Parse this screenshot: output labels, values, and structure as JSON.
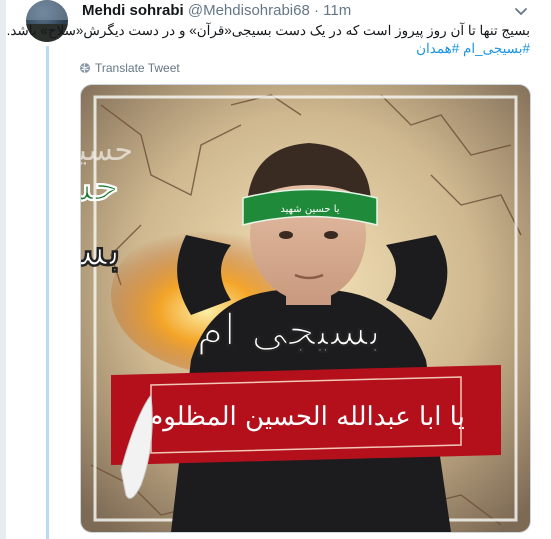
{
  "tweet": {
    "author_name": "Mehdi sohrabi",
    "handle": "@Mehdisohrabi68",
    "separator": "·",
    "time": "11m",
    "text_line1": "بسیج تنها تا آن روز پیروز است که در یک دست بسیجی«قرآن» و در دست دیگرش«سلاح» باشد.",
    "hashtags": "#بسیجی_ام #همدان",
    "translate_label": "Translate Tweet"
  },
  "image": {
    "calligraphy_top_small": "حسین",
    "calligraphy_top_large": "حسین",
    "calligraphy_mid": "بسیجی",
    "headband_text": "یا حسین شهید",
    "calligraphy_right": "بسیجی ام",
    "banner_text": "یا ابا عبدالله الحسین المظلوم"
  },
  "icons": {
    "avatar": "avatar",
    "chevron": "chevron-down-icon",
    "globe": "globe-icon"
  },
  "colors": {
    "link": "#1b95e0",
    "thread_line": "#b9dcf5",
    "secondary_text": "#657786",
    "banner_red": "#b3101c",
    "headband_green": "#1f8a3a"
  }
}
